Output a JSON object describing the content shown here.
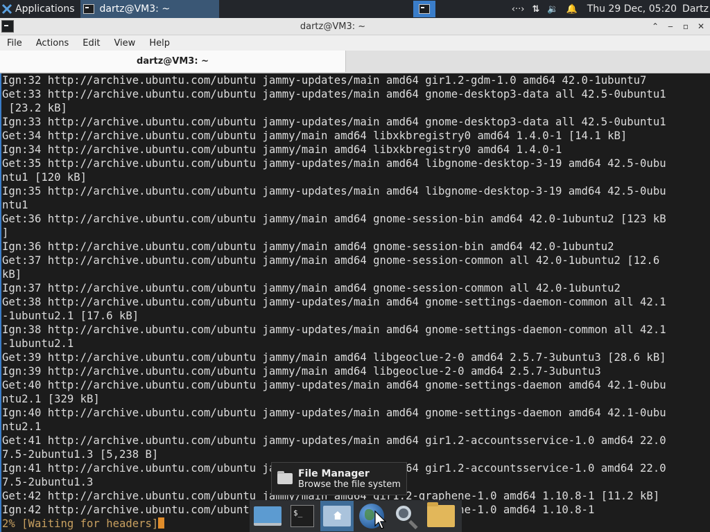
{
  "panel": {
    "applications_label": "Applications",
    "task_label": "dartz@VM3: ~",
    "clock": "Thu 29 Dec, 05:20",
    "user": "Dartz",
    "tray_icons": [
      "network-arrows-icon",
      "transfer-icon",
      "volume-icon",
      "notification-bell-icon"
    ]
  },
  "window": {
    "title": "dartz@VM3: ~",
    "controls": [
      "^",
      "_",
      "□",
      "✕"
    ]
  },
  "menu": {
    "file": "File",
    "actions": "Actions",
    "edit": "Edit",
    "view": "View",
    "help": "Help"
  },
  "tab": {
    "label": "dartz@VM3: ~"
  },
  "terminal": {
    "lines": [
      "Ign:32 http://archive.ubuntu.com/ubuntu jammy-updates/main amd64 gir1.2-gdm-1.0 amd64 42.0-1ubuntu7",
      "Get:33 http://archive.ubuntu.com/ubuntu jammy-updates/main amd64 gnome-desktop3-data all 42.5-0ubuntu1",
      " [23.2 kB]",
      "Ign:33 http://archive.ubuntu.com/ubuntu jammy-updates/main amd64 gnome-desktop3-data all 42.5-0ubuntu1",
      "Get:34 http://archive.ubuntu.com/ubuntu jammy/main amd64 libxkbregistry0 amd64 1.4.0-1 [14.1 kB]",
      "Ign:34 http://archive.ubuntu.com/ubuntu jammy/main amd64 libxkbregistry0 amd64 1.4.0-1",
      "Get:35 http://archive.ubuntu.com/ubuntu jammy-updates/main amd64 libgnome-desktop-3-19 amd64 42.5-0ubu",
      "ntu1 [120 kB]",
      "Ign:35 http://archive.ubuntu.com/ubuntu jammy-updates/main amd64 libgnome-desktop-3-19 amd64 42.5-0ubu",
      "ntu1",
      "Get:36 http://archive.ubuntu.com/ubuntu jammy/main amd64 gnome-session-bin amd64 42.0-1ubuntu2 [123 kB",
      "]",
      "Ign:36 http://archive.ubuntu.com/ubuntu jammy/main amd64 gnome-session-bin amd64 42.0-1ubuntu2",
      "Get:37 http://archive.ubuntu.com/ubuntu jammy/main amd64 gnome-session-common all 42.0-1ubuntu2 [12.6",
      "kB]",
      "Ign:37 http://archive.ubuntu.com/ubuntu jammy/main amd64 gnome-session-common all 42.0-1ubuntu2",
      "Get:38 http://archive.ubuntu.com/ubuntu jammy-updates/main amd64 gnome-settings-daemon-common all 42.1",
      "-1ubuntu2.1 [17.6 kB]",
      "Ign:38 http://archive.ubuntu.com/ubuntu jammy-updates/main amd64 gnome-settings-daemon-common all 42.1",
      "-1ubuntu2.1",
      "Get:39 http://archive.ubuntu.com/ubuntu jammy/main amd64 libgeoclue-2-0 amd64 2.5.7-3ubuntu3 [28.6 kB]",
      "Ign:39 http://archive.ubuntu.com/ubuntu jammy/main amd64 libgeoclue-2-0 amd64 2.5.7-3ubuntu3",
      "Get:40 http://archive.ubuntu.com/ubuntu jammy-updates/main amd64 gnome-settings-daemon amd64 42.1-0ubu",
      "ntu2.1 [329 kB]",
      "Ign:40 http://archive.ubuntu.com/ubuntu jammy-updates/main amd64 gnome-settings-daemon amd64 42.1-0ubu",
      "ntu2.1",
      "Get:41 http://archive.ubuntu.com/ubuntu jammy-updates/main amd64 gir1.2-accountsservice-1.0 amd64 22.0",
      "7.5-2ubuntu1.3 [5,238 B]",
      "Ign:41 http://archive.ubuntu.com/ubuntu jammy-updates/main amd64 gir1.2-accountsservice-1.0 amd64 22.0",
      "7.5-2ubuntu1.3",
      "Get:42 http://archive.ubuntu.com/ubuntu jammy/main amd64 gir1.2-graphene-1.0 amd64 1.10.8-1 [11.2 kB]",
      "Ign:42 http://archive.ubuntu.com/ubuntu jammy/main amd64 gir1.2-graphene-1.0 amd64 1.10.8-1"
    ],
    "progress_line": "2% [Waiting for headers]"
  },
  "tooltip": {
    "title": "File Manager",
    "subtitle": "Browse the file system"
  },
  "dock": {
    "items": [
      "show-desktop-icon",
      "terminal-icon",
      "home-folder-icon",
      "web-browser-icon",
      "app-finder-icon",
      "files-icon"
    ]
  }
}
